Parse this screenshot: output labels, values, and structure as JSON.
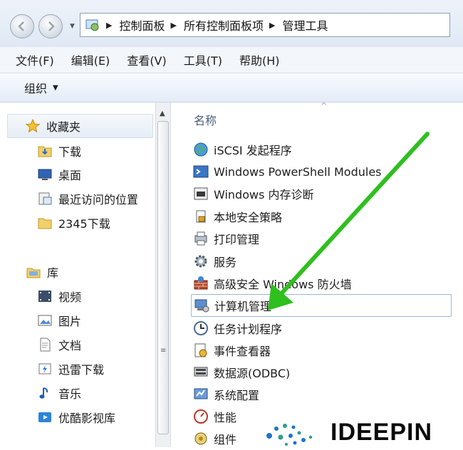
{
  "address_bar": {
    "breadcrumbs": [
      "控制面板",
      "所有控制面板项",
      "管理工具"
    ]
  },
  "menu": [
    "文件(F)",
    "编辑(E)",
    "查看(V)",
    "工具(T)",
    "帮助(H)"
  ],
  "toolbar": {
    "organize_label": "组织"
  },
  "nav_pane": {
    "favorites_label": "收藏夹",
    "favorites": [
      {
        "label": "下载",
        "icon": "download-folder-icon"
      },
      {
        "label": "桌面",
        "icon": "desktop-icon"
      },
      {
        "label": "最近访问的位置",
        "icon": "recent-places-icon"
      },
      {
        "label": "2345下载",
        "icon": "folder-icon"
      }
    ],
    "libraries_label": "库",
    "libraries": [
      {
        "label": "视频",
        "icon": "video-library-icon"
      },
      {
        "label": "图片",
        "icon": "pictures-library-icon"
      },
      {
        "label": "文档",
        "icon": "documents-library-icon"
      },
      {
        "label": "迅雷下载",
        "icon": "thunder-download-icon"
      },
      {
        "label": "音乐",
        "icon": "music-library-icon"
      },
      {
        "label": "优酷影视库",
        "icon": "youku-library-icon"
      }
    ]
  },
  "content": {
    "column_header": "名称",
    "items": [
      {
        "label": "iSCSI 发起程序",
        "icon": "iscsi-globe-icon"
      },
      {
        "label": "Windows PowerShell Modules",
        "icon": "powershell-icon"
      },
      {
        "label": "Windows 内存诊断",
        "icon": "memory-diagnostic-icon"
      },
      {
        "label": "本地安全策略",
        "icon": "security-policy-icon"
      },
      {
        "label": "打印管理",
        "icon": "print-management-icon"
      },
      {
        "label": "服务",
        "icon": "services-gear-icon"
      },
      {
        "label": "高级安全 Windows 防火墙",
        "icon": "firewall-icon"
      },
      {
        "label": "计算机管理",
        "icon": "computer-management-icon"
      },
      {
        "label": "任务计划程序",
        "icon": "task-scheduler-icon"
      },
      {
        "label": "事件查看器",
        "icon": "event-viewer-icon"
      },
      {
        "label": "数据源(ODBC)",
        "icon": "odbc-icon"
      },
      {
        "label": "系统配置",
        "icon": "system-config-icon"
      },
      {
        "label": "性能",
        "icon": "performance-icon"
      },
      {
        "label": "组件",
        "icon": "component-icon"
      }
    ],
    "selected_item": "计算机管理"
  },
  "watermark": {
    "text": "IDEEPIN"
  },
  "colors": {
    "arrow_green": "#2fbf1f",
    "selection_border": "#9bb8d9",
    "logo_blue": "#1e73c8"
  }
}
